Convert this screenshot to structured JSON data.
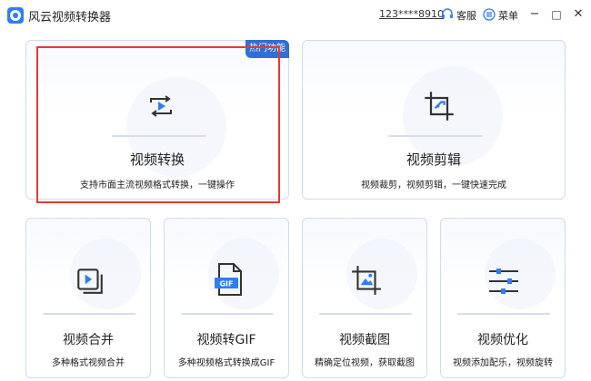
{
  "app": {
    "title": "风云视频转换器"
  },
  "header": {
    "account": "123****8910",
    "service": "客服",
    "menu": "菜单"
  },
  "window": {
    "minimize": "−",
    "maximize": "□",
    "close": "✕"
  },
  "cards": {
    "convert": {
      "title": "视频转换",
      "desc": "支持市面主流视频格式转换，一键操作",
      "badge": "热门功能"
    },
    "edit": {
      "title": "视频剪辑",
      "desc": "视频裁剪，视频剪辑，一键快速完成"
    },
    "merge": {
      "title": "视频合并",
      "desc": "多种格式视频合并"
    },
    "gif": {
      "title": "视频转GIF",
      "desc": "多种视频格式转换成GIF",
      "icon_text": "GIF"
    },
    "screenshot": {
      "title": "视频截图",
      "desc": "精确定位视频，获取截图"
    },
    "optimize": {
      "title": "视频优化",
      "desc": "视频添加配乐，视频旋转"
    }
  },
  "icons": {
    "convert": "video-convert-icon",
    "edit": "crop-icon",
    "merge": "video-merge-icon",
    "gif": "gif-file-icon",
    "screenshot": "image-crop-icon",
    "optimize": "sliders-icon"
  },
  "colors": {
    "accent": "#2f7cf6",
    "badge": "#2f6fd6",
    "highlight": "#e53935",
    "card_border": "#cfdcee"
  }
}
